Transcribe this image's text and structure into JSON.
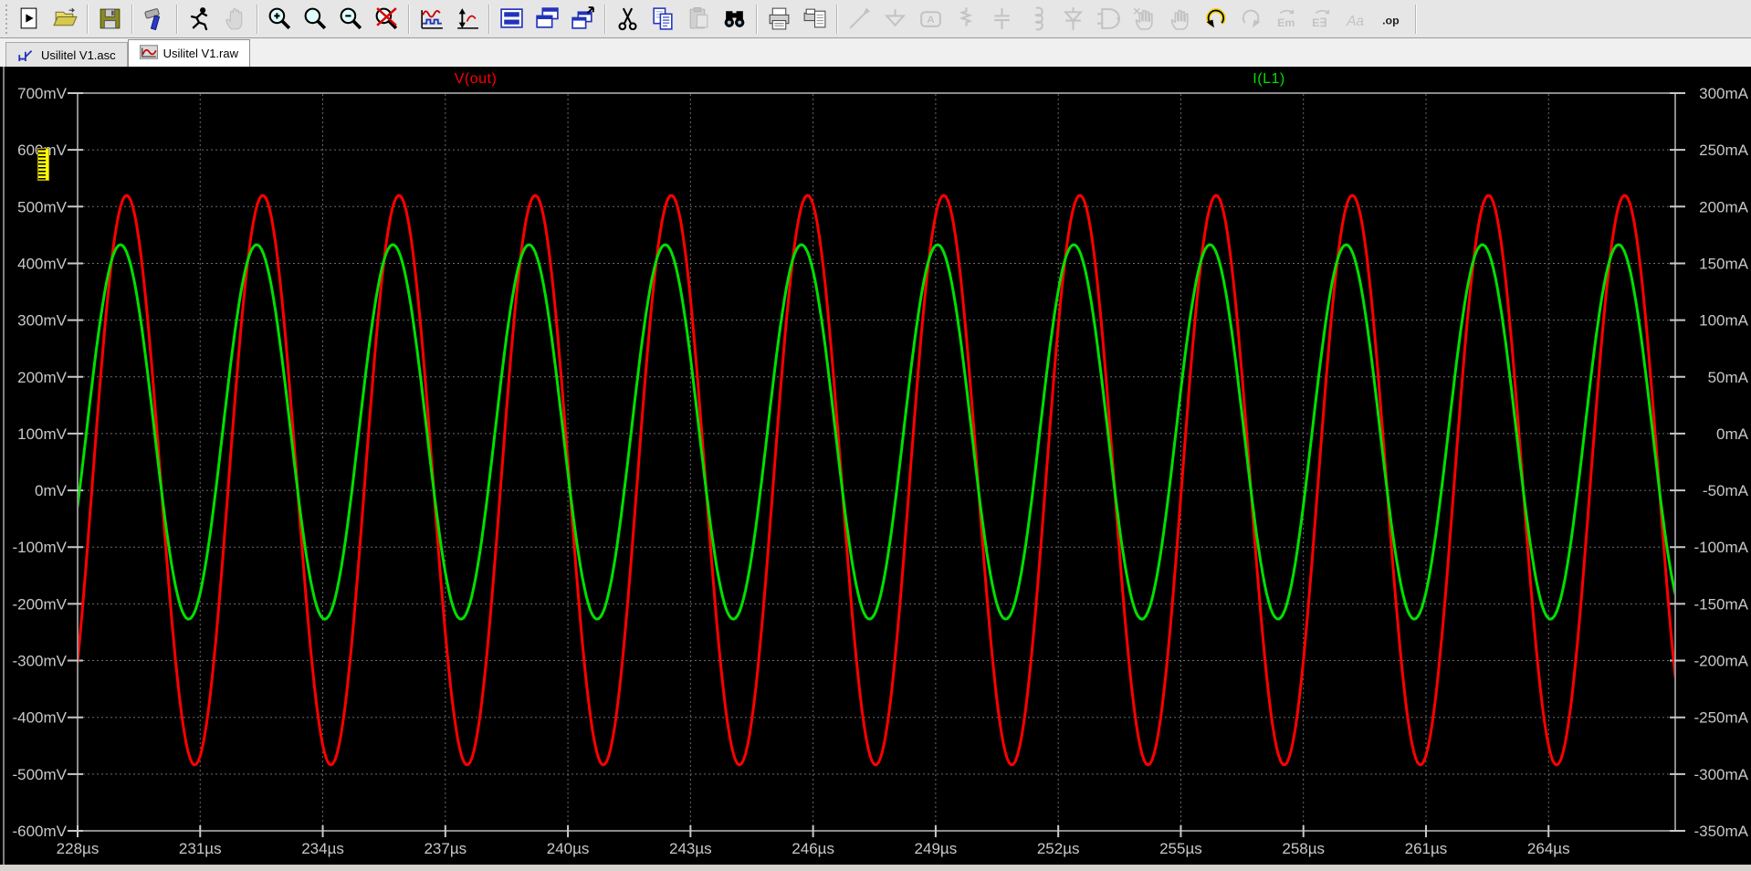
{
  "toolbar": {
    "buttons": [
      {
        "id": "new-schematic",
        "label": "New Schematic",
        "enabled": true,
        "sep": false
      },
      {
        "id": "open",
        "label": "Open",
        "enabled": true,
        "sep": true
      },
      {
        "id": "save",
        "label": "Save",
        "enabled": true,
        "sep": true
      },
      {
        "id": "control-panel",
        "label": "Control Panel",
        "enabled": true,
        "sep": true
      },
      {
        "id": "run",
        "label": "Run",
        "enabled": true,
        "sep": false
      },
      {
        "id": "halt",
        "label": "Halt",
        "enabled": false,
        "sep": true
      },
      {
        "id": "zoom-in",
        "label": "Zoom to Rectangle",
        "enabled": true,
        "sep": false
      },
      {
        "id": "zoom-extents",
        "label": "Zoom Full Extents",
        "enabled": true,
        "sep": false
      },
      {
        "id": "zoom-out",
        "label": "Zoom Out",
        "enabled": true,
        "sep": false
      },
      {
        "id": "zoom-back",
        "label": "Undo Zoom",
        "enabled": true,
        "sep": true
      },
      {
        "id": "plot-settings",
        "label": "Plot Settings",
        "enabled": true,
        "sep": false
      },
      {
        "id": "autorange",
        "label": "Autorange Y-axis",
        "enabled": true,
        "sep": true
      },
      {
        "id": "tile-windows",
        "label": "Tile Windows",
        "enabled": true,
        "sep": false
      },
      {
        "id": "cascade-windows",
        "label": "Cascade Windows",
        "enabled": true,
        "sep": false
      },
      {
        "id": "arrange-windows",
        "label": "Arrange Windows",
        "enabled": true,
        "sep": true
      },
      {
        "id": "cut",
        "label": "Cut",
        "enabled": true,
        "sep": false
      },
      {
        "id": "copy",
        "label": "Copy",
        "enabled": true,
        "sep": false
      },
      {
        "id": "paste",
        "label": "Paste",
        "enabled": false,
        "sep": false
      },
      {
        "id": "find",
        "label": "Find",
        "enabled": true,
        "sep": true
      },
      {
        "id": "print",
        "label": "Print",
        "enabled": true,
        "sep": false
      },
      {
        "id": "print-preview",
        "label": "Print Preview",
        "enabled": true,
        "sep": true
      },
      {
        "id": "wire",
        "label": "Draw Wire",
        "enabled": false,
        "sep": false
      },
      {
        "id": "ground",
        "label": "Ground",
        "enabled": false,
        "sep": false
      },
      {
        "id": "net-label",
        "label": "Net Label",
        "enabled": false,
        "sep": false
      },
      {
        "id": "resistor",
        "label": "Resistor",
        "enabled": false,
        "sep": false
      },
      {
        "id": "capacitor",
        "label": "Capacitor",
        "enabled": false,
        "sep": false
      },
      {
        "id": "inductor",
        "label": "Inductor",
        "enabled": false,
        "sep": false
      },
      {
        "id": "diode",
        "label": "Diode",
        "enabled": false,
        "sep": false
      },
      {
        "id": "component",
        "label": "Component",
        "enabled": false,
        "sep": false
      },
      {
        "id": "move",
        "label": "Move",
        "enabled": false,
        "sep": false
      },
      {
        "id": "drag",
        "label": "Drag",
        "enabled": false,
        "sep": false
      },
      {
        "id": "undo",
        "label": "Undo",
        "enabled": true,
        "sep": false
      },
      {
        "id": "redo",
        "label": "Redo",
        "enabled": false,
        "sep": false
      },
      {
        "id": "mirror",
        "label": "Mirror",
        "enabled": false,
        "sep": false
      },
      {
        "id": "rotate",
        "label": "Rotate",
        "enabled": false,
        "sep": false
      },
      {
        "id": "text-tool",
        "label": "Text",
        "enabled": false,
        "sep": false
      },
      {
        "id": "spice-directive",
        "label": "SPICE Directive",
        "enabled": true,
        "sep": true
      }
    ]
  },
  "tabs": [
    {
      "label": "Usilitel V1.asc",
      "icon": "schematic-icon",
      "active": false
    },
    {
      "label": "Usilitel V1.raw",
      "icon": "waveform-icon",
      "active": true
    }
  ],
  "colors": {
    "plot_bg": "#000000",
    "grid": "#6a6a6a",
    "axis_border": "#8c8c8c",
    "axis_text": "#c8c8c8",
    "chrome_strip": "#d6d3ce",
    "trace_red": "#ff0000",
    "trace_green": "#00e000"
  },
  "chart_data": {
    "type": "line",
    "title": "",
    "grid": true,
    "legend_position": "top-inline",
    "x_axis": {
      "unit": "µs",
      "min": 228,
      "max": 267.1,
      "tick_interval": 3,
      "tick_values": [
        228,
        231,
        234,
        237,
        240,
        243,
        246,
        249,
        252,
        255,
        258,
        261,
        264
      ],
      "tick_labels": [
        "228µs",
        "231µs",
        "234µs",
        "237µs",
        "240µs",
        "243µs",
        "246µs",
        "249µs",
        "252µs",
        "255µs",
        "258µs",
        "261µs",
        "264µs"
      ]
    },
    "y_axis_left": {
      "unit": "mV",
      "min": -600,
      "max": 700,
      "tick_interval": 100,
      "tick_values": [
        700,
        600,
        500,
        400,
        300,
        200,
        100,
        0,
        -100,
        -200,
        -300,
        -400,
        -500,
        -600
      ],
      "tick_labels": [
        "700mV",
        "600mV",
        "500mV",
        "400mV",
        "300mV",
        "200mV",
        "100mV",
        "0mV",
        "-100mV",
        "-200mV",
        "-300mV",
        "-400mV",
        "-500mV",
        "-600mV"
      ]
    },
    "y_axis_right": {
      "unit": "mA",
      "min": -350,
      "max": 300,
      "tick_interval": 50,
      "tick_values": [
        300,
        250,
        200,
        150,
        100,
        50,
        0,
        -50,
        -100,
        -150,
        -200,
        -250,
        -300,
        -350
      ],
      "tick_labels": [
        "300mA",
        "250mA",
        "200mA",
        "150mA",
        "100mA",
        "50mA",
        "0mA",
        "-50mA",
        "-100mA",
        "-150mA",
        "-200mA",
        "-250mA",
        "-300mA",
        "-350mA"
      ]
    },
    "series": [
      {
        "name": "V(out)",
        "color": "#ff0000",
        "axis": "left",
        "unit": "mV",
        "shape": "sine",
        "offset": 18,
        "amplitude": 502,
        "period_us": 3.333,
        "peak_time_us": 229.2,
        "peak_value": 520,
        "trough_value": -484
      },
      {
        "name": "I(L1)",
        "color": "#00e000",
        "axis": "right",
        "unit": "mA",
        "shape": "sine",
        "offset": 1.5,
        "amplitude": 165,
        "period_us": 3.333,
        "peak_time_us": 229.05,
        "peak_value": 166,
        "trough_value": -163
      }
    ]
  }
}
